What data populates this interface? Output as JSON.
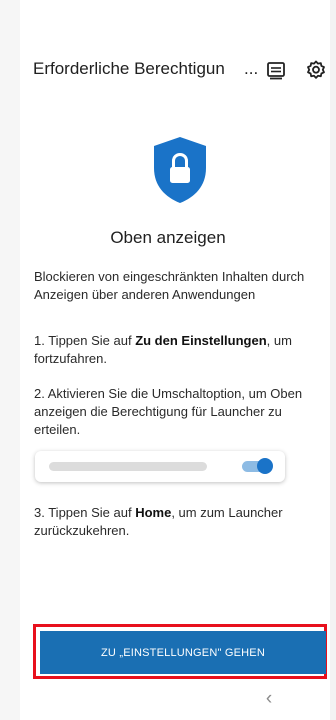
{
  "header": {
    "title": "Erforderliche Berechtigun",
    "title_ellipsis": "...",
    "icons": [
      "subtitles-icon",
      "gear-icon"
    ]
  },
  "shield_icon": "lock-shield-icon",
  "heading": "Oben anzeigen",
  "description": "Blockieren von eingeschränkten Inhalten durch Anzeigen über anderen Anwendungen",
  "steps": [
    {
      "prefix": "1. Tippen Sie auf ",
      "bold": "Zu den Einstellungen",
      "suffix": ", um fortzufahren."
    },
    {
      "text": " 2. Aktivieren Sie die Umschaltoption, um Oben anzeigen die Berechtigung für Launcher zu erteilen."
    },
    {
      "prefix": "3. Tippen Sie auf ",
      "bold": "Home",
      "suffix": ", um zum Launcher zurückzukehren."
    }
  ],
  "toggle_state": "on",
  "cta_label": "ZU „EINSTELLUNGEN\" GEHEN",
  "nav_back_glyph": "‹",
  "colors": {
    "accent": "#1a6fb3",
    "toggle_knob": "#1a73c8",
    "toggle_track": "#8dbbe4",
    "highlight_outline": "#e8101c"
  }
}
